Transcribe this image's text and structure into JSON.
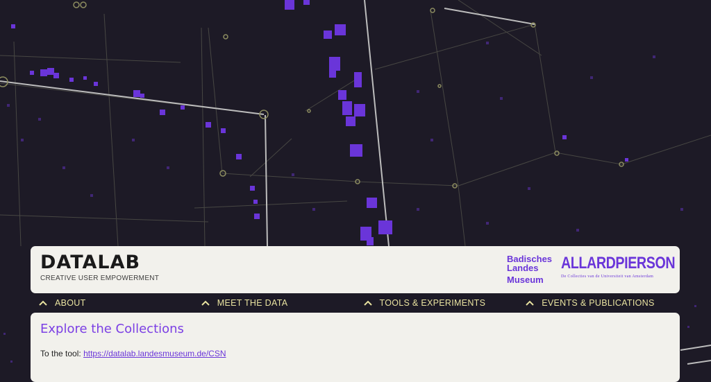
{
  "colors": {
    "background": "#1d1a26",
    "accent": "#6a35d9",
    "nav_text": "#e9e3a0",
    "card": "#f2f1ec"
  },
  "header": {
    "title": "DATALAB",
    "subtitle": "CREATIVE USER EMPOWERMENT",
    "logos": {
      "badisches": [
        "Badisches",
        "Landes",
        "Museum"
      ],
      "allard_pierson": "ALLARDPIERSON",
      "allard_pierson_sub": "De Collecties van de Universiteit van Amsterdam"
    }
  },
  "nav": {
    "items": [
      {
        "label": "ABOUT",
        "icon": "chevron-up-icon"
      },
      {
        "label": "MEET THE DATA",
        "icon": "chevron-up-icon"
      },
      {
        "label": "TOOLS & EXPERIMENTS",
        "icon": "chevron-up-icon"
      },
      {
        "label": "EVENTS & PUBLICATIONS",
        "icon": "chevron-up-icon"
      }
    ]
  },
  "content": {
    "title": "Explore the Collections",
    "tool_prefix": "To the tool:",
    "tool_link": "https://datalab.landesmuseum.de/CSN"
  }
}
